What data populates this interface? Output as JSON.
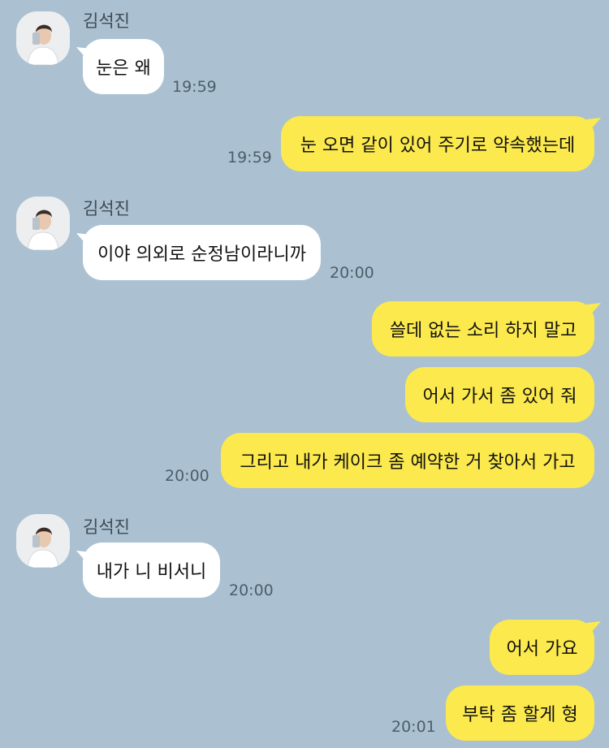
{
  "chat": {
    "sender_name": "김석진",
    "messages": [
      {
        "from": "them",
        "text": "눈은 왜",
        "time": "19:59"
      },
      {
        "from": "me",
        "text": "눈 오면 같이 있어 주기로 약속했는데",
        "time": "19:59"
      },
      {
        "from": "them",
        "text": "이야 의외로 순정남이라니까",
        "time": "20:00"
      },
      {
        "from": "me",
        "text": "쓸데 없는 소리 하지 말고",
        "time": ""
      },
      {
        "from": "me",
        "text": "어서 가서 좀 있어 줘",
        "time": ""
      },
      {
        "from": "me",
        "text": "그리고 내가 케이크 좀 예약한 거 찾아서 가고",
        "time": "20:00"
      },
      {
        "from": "them",
        "text": "내가 니 비서니",
        "time": "20:00"
      },
      {
        "from": "me",
        "text": "어서 가요",
        "time": ""
      },
      {
        "from": "me",
        "text": "부탁 좀 할게 형",
        "time": "20:01"
      }
    ]
  },
  "colors": {
    "background": "#abc1d1",
    "incoming_bubble": "#ffffff",
    "outgoing_bubble": "#fbe94e"
  },
  "icons": {
    "avatar": "profile-photo"
  }
}
